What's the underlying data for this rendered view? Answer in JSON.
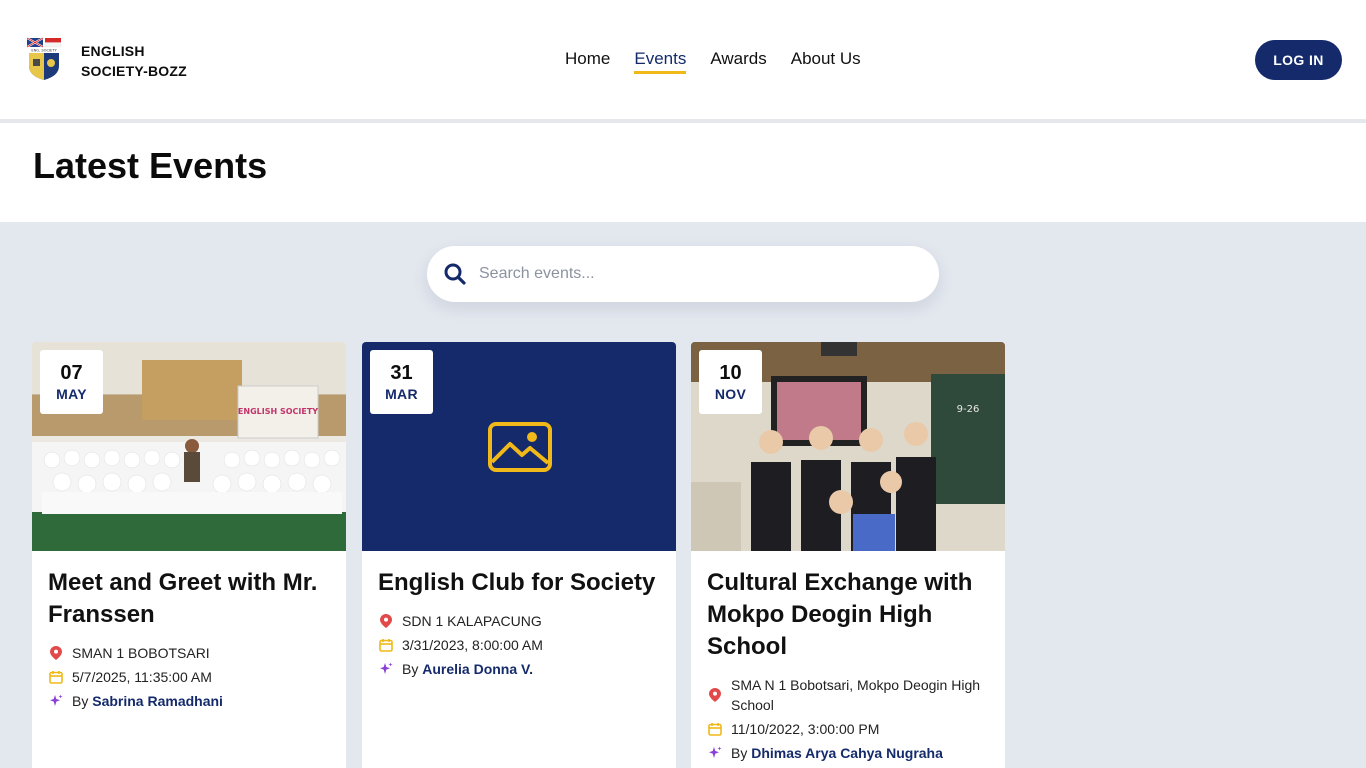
{
  "brand": {
    "line1": "ENGLISH",
    "line2": "SOCIETY-BOZZ"
  },
  "nav": {
    "items": [
      "Home",
      "Events",
      "Awards",
      "About Us"
    ],
    "active": "Events"
  },
  "header": {
    "login_label": "LOG IN"
  },
  "page": {
    "title": "Latest Events"
  },
  "search": {
    "placeholder": "Search events..."
  },
  "events": [
    {
      "day": "07",
      "month": "MAY",
      "title": "Meet and Greet with Mr. Franssen",
      "location": "SMAN 1 BOBOTSARI",
      "datetime": "5/7/2025, 11:35:00 AM",
      "by_prefix": "By",
      "author": "Sabrina Ramadhani",
      "image": "photo"
    },
    {
      "day": "31",
      "month": "MAR",
      "title": "English Club for Society",
      "location": "SDN 1 KALAPACUNG",
      "datetime": "3/31/2023, 8:00:00 AM",
      "by_prefix": "By",
      "author": "Aurelia Donna V.",
      "image": "image-placeholder-icon"
    },
    {
      "day": "10",
      "month": "NOV",
      "title": "Cultural Exchange with Mokpo Deogin High School",
      "location": "SMA N 1 Bobotsari, Mokpo Deogin High School",
      "datetime": "11/10/2022, 3:00:00 PM",
      "by_prefix": "By",
      "author": "Dhimas Arya Cahya Nugraha",
      "image": "photo"
    }
  ],
  "colors": {
    "navy": "#142a6b",
    "accent": "#f0b818",
    "location_pin": "#e24a4a",
    "calendar": "#f0b818",
    "sparkle": "#8a3fd6",
    "background": "#e3e7ee"
  }
}
